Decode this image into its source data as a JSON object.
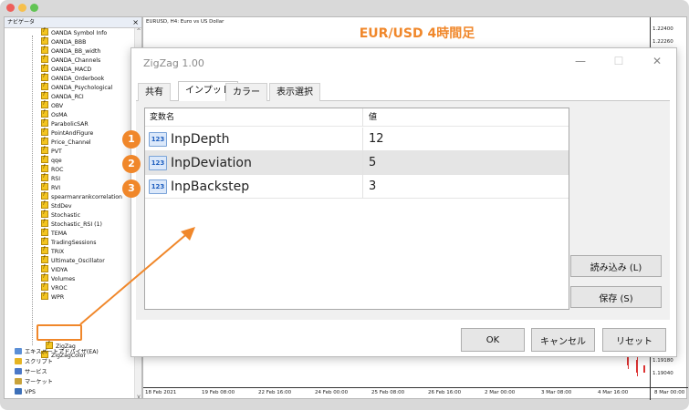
{
  "navigator": {
    "title": "ナビゲータ",
    "close": "×",
    "items": [
      "OANDA Symbol Info",
      "OANDA_BBB",
      "OANDA_BB_width",
      "OANDA_Channels",
      "OANDA_MACD",
      "OANDA_Orderbook",
      "OANDA_Psychological",
      "OANDA_RCI",
      "OBV",
      "OsMA",
      "ParabolicSAR",
      "PointAndFigure",
      "Price_Channel",
      "PVT",
      "qqe",
      "ROC",
      "RSI",
      "RVI",
      "spearmanrankcorrelation",
      "StdDev",
      "Stochastic",
      "Stochastic_RSI (1)",
      "TEMA",
      "TradingSessions",
      "TRIX",
      "Ultimate_Oscillator",
      "VIDYA",
      "Volumes",
      "VROC",
      "WPR"
    ],
    "zigzag": "ZigZag",
    "zigzag_color": "ZigZagColor",
    "bottom": [
      "エキスパートアドバイザ(EA)",
      "スクリプト",
      "サービス",
      "マーケット",
      "VPS"
    ]
  },
  "chart": {
    "symbol_title": "EURUSD, H4:  Euro vs US Dollar",
    "heading": "EUR/USD 4時間足",
    "prices": [
      "1.22400",
      "1.22260",
      "1.19180",
      "1.19040"
    ],
    "times": [
      "18 Feb 2021",
      "19 Feb 08:00",
      "22 Feb 16:00",
      "24 Feb 00:00",
      "25 Feb 08:00",
      "26 Feb 16:00",
      "2 Mar 00:00",
      "3 Mar 08:00",
      "4 Mar 16:00",
      "8 Mar 00:00"
    ]
  },
  "dialog": {
    "title": "ZigZag 1.00",
    "minimize": "—",
    "maximize": "☐",
    "close": "✕",
    "tabs": [
      "共有",
      "インプット",
      "カラー",
      "表示選択"
    ],
    "table": {
      "headers": [
        "変数名",
        "値"
      ],
      "rows": [
        {
          "icon": "123",
          "name": "InpDepth",
          "value": "12"
        },
        {
          "icon": "123",
          "name": "InpDeviation",
          "value": "5"
        },
        {
          "icon": "123",
          "name": "InpBackstep",
          "value": "3"
        }
      ]
    },
    "load_button": "読み込み (L)",
    "save_button": "保存 (S)",
    "ok_button": "OK",
    "cancel_button": "キャンセル",
    "reset_button": "リセット"
  },
  "badges": [
    "1",
    "2",
    "3"
  ],
  "colors": {
    "accent": "#f0872a",
    "selected_row": "#e5e5e5"
  }
}
